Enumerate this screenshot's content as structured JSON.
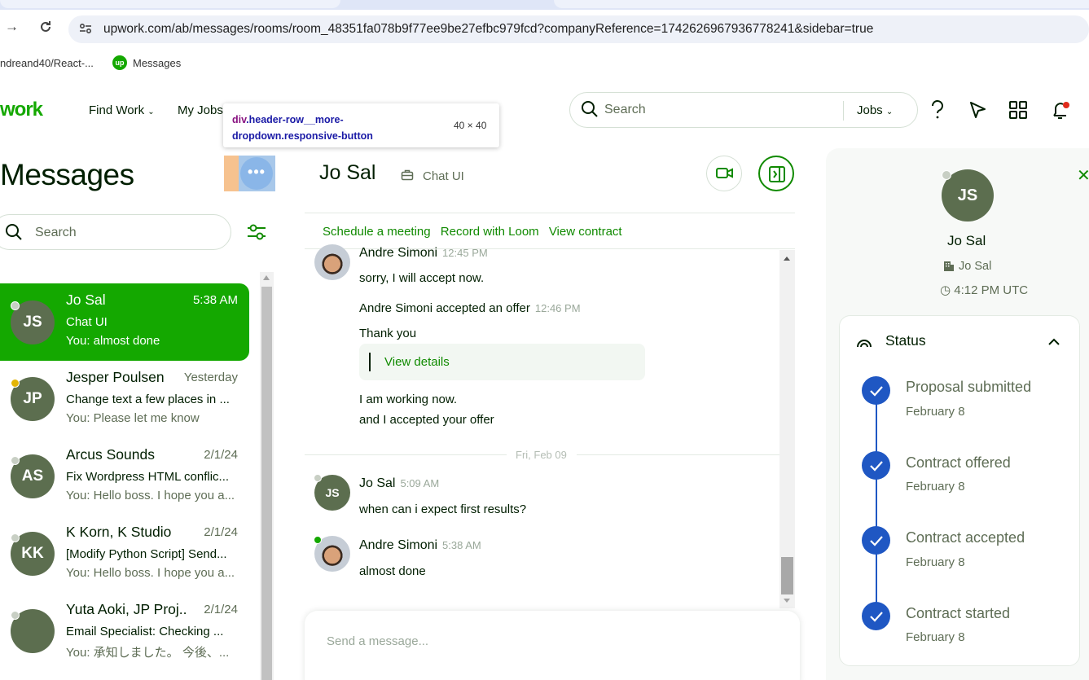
{
  "browser": {
    "url": "upwork.com/ab/messages/rooms/room_48351fa078b9f77ee9be27efbc979fcd?companyReference=1742626967936778241&sidebar=true",
    "bookmarks": [
      "ndreand40/React-...",
      "Messages"
    ]
  },
  "header": {
    "logo": "work",
    "nav": [
      "Find Work",
      "My Jobs"
    ],
    "search_placeholder": "Search",
    "search_scope": "Jobs"
  },
  "devtools_tooltip": {
    "tag": "div",
    "class_text": ".header-row__more-dropdown.responsive-button",
    "size": "40 × 40"
  },
  "sidebar": {
    "title": "Messages",
    "search_placeholder": "Search",
    "conversations": [
      {
        "initials": "JS",
        "name": "Jo Sal",
        "time": "5:38 AM",
        "subtitle": "Chat UI",
        "last": "You: almost done",
        "active": true,
        "status": "offline"
      },
      {
        "initials": "JP",
        "name": "Jesper Poulsen",
        "time": "Yesterday",
        "subtitle": "Change text a few places in ...",
        "last": "You: Please let me know",
        "active": false,
        "status": "away"
      },
      {
        "initials": "AS",
        "name": "Arcus Sounds",
        "time": "2/1/24",
        "subtitle": "Fix Wordpress HTML conflic...",
        "last": "You: Hello boss. I hope you a...",
        "active": false,
        "status": "offline"
      },
      {
        "initials": "KK",
        "name": "K Korn, K Studio",
        "time": "2/1/24",
        "subtitle": "[Modify Python Script] Send...",
        "last": "You: Hello boss. I hope you a...",
        "active": false,
        "status": "offline"
      },
      {
        "initials": "",
        "name": "Yuta Aoki, JP Proj...",
        "time": "2/1/24",
        "subtitle": "Email Specialist: Checking ...",
        "last": "You: 承知しました。 今後、...",
        "active": false,
        "status": "offline"
      }
    ]
  },
  "chat": {
    "name": "Jo Sal",
    "context": "Chat UI",
    "links": [
      "Schedule a meeting",
      "Record with Loom",
      "View contract"
    ],
    "messages": {
      "m1_sender": "Andre Simoni",
      "m1_time": "12:45 PM",
      "m1_text": "sorry, I will accept now.",
      "offer_sender": "Andre Simoni",
      "offer_text": "accepted an offer",
      "offer_time": "12:46 PM",
      "thank_you": "Thank you",
      "view_details": "View details",
      "working": "I am working now.",
      "accepted": "and I accepted your offer",
      "day_divider": "Fri, Feb 09",
      "m2_sender": "Jo Sal",
      "m2_initials": "JS",
      "m2_time": "5:09 AM",
      "m2_text": "when can i expect first results?",
      "m3_sender": "Andre Simoni",
      "m3_time": "5:38 AM",
      "m3_text": "almost done"
    },
    "compose_placeholder": "Send a message..."
  },
  "profile": {
    "initials": "JS",
    "name": "Jo Sal",
    "company": "Jo Sal",
    "timezone": "4:12 PM UTC",
    "status_title": "Status",
    "timeline": [
      {
        "label": "Proposal submitted",
        "date": "February 8"
      },
      {
        "label": "Contract offered",
        "date": "February 8"
      },
      {
        "label": "Contract accepted",
        "date": "February 8"
      },
      {
        "label": "Contract started",
        "date": "February 8"
      }
    ]
  },
  "colors": {
    "brand_green": "#14a800",
    "link_green": "#108a00",
    "timeline_blue": "#1f57c3"
  }
}
